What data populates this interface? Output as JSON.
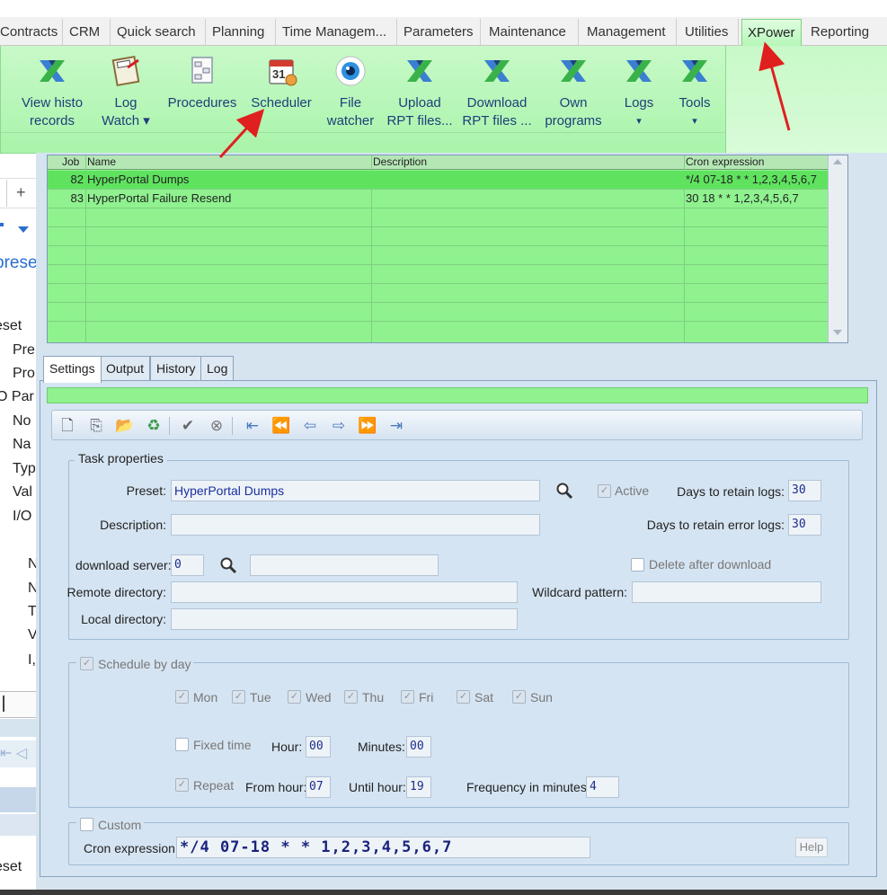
{
  "menu": {
    "tabs": [
      "Contracts",
      "CRM",
      "Quick search",
      "Planning",
      "Time Managem...",
      "Parameters",
      "Maintenance",
      "Management",
      "Utilities",
      "XPower",
      "Reporting"
    ],
    "active": "XPower"
  },
  "ribbon": {
    "buttons": [
      {
        "line1": "View histo",
        "line2": "records"
      },
      {
        "line1": "Log",
        "line2": "Watch ▾"
      },
      {
        "line1": "Procedures",
        "line2": ""
      },
      {
        "line1": "Scheduler",
        "line2": ""
      },
      {
        "line1": "File",
        "line2": "watcher"
      },
      {
        "line1": "Upload",
        "line2": "RPT files..."
      },
      {
        "line1": "Download",
        "line2": "RPT files ..."
      },
      {
        "line1": "Own",
        "line2": "programs"
      },
      {
        "line1": "Logs",
        "line2": "▾"
      },
      {
        "line1": "Tools",
        "line2": "▾"
      }
    ],
    "calendar_day": "31"
  },
  "left_panel": {
    "plus": "+",
    "preset_title": "prese",
    "items": [
      "eset",
      "Pre",
      "Pro",
      "O Par",
      "No",
      "Na",
      "Typ",
      "Val",
      "I/O",
      "N",
      "N",
      "T",
      "V",
      "I,",
      "eset"
    ]
  },
  "grid": {
    "columns": [
      "Job",
      "Name",
      "Description",
      "Cron expression"
    ],
    "rows": [
      {
        "job": "82",
        "name": "HyperPortal Dumps",
        "description": "",
        "cron": "*/4 07-18 * * 1,2,3,4,5,6,7"
      },
      {
        "job": "83",
        "name": "HyperPortal Failure Resend",
        "description": "",
        "cron": "30 18 * * 1,2,3,4,5,6,7"
      }
    ]
  },
  "panel_tabs": [
    "Settings",
    "Output",
    "History",
    "Log"
  ],
  "task": {
    "legend": "Task properties",
    "preset_label": "Preset:",
    "preset_value": "HyperPortal Dumps",
    "active_label": "Active",
    "days_logs_label": "Days to retain logs:",
    "days_logs_value": "30",
    "description_label": "Description:",
    "description_value": "",
    "days_error_label": "Days to retain error logs:",
    "days_error_value": "30",
    "download_server_label": "download server:",
    "download_server_value": "0",
    "delete_after_label": "Delete after download",
    "remote_dir_label": "Remote directory:",
    "wildcard_label": "Wildcard pattern:",
    "local_dir_label": "Local directory:"
  },
  "schedule": {
    "legend": "Schedule by day",
    "days": [
      "Mon",
      "Tue",
      "Wed",
      "Thu",
      "Fri",
      "Sat",
      "Sun"
    ],
    "fixed_time_label": "Fixed time",
    "hour_label": "Hour:",
    "hour_value": "00",
    "minutes_label": "Minutes:",
    "minutes_value": "00",
    "repeat_label": "Repeat",
    "from_hour_label": "From hour:",
    "from_hour_value": "07",
    "until_hour_label": "Until hour:",
    "until_hour_value": "19",
    "frequency_label": "Frequency in minutes:",
    "frequency_value": "4"
  },
  "custom": {
    "legend": "Custom",
    "cron_label": "Cron expression:",
    "cron_value": "*/4 07-18 * * 1,2,3,4,5,6,7",
    "help_label": "Help"
  },
  "colors": {
    "grid_green": "#8ff28f",
    "ribbon_green": "#b6f7b8",
    "panel_blue": "#d5e4f2",
    "arrow_red": "#e0201e"
  }
}
